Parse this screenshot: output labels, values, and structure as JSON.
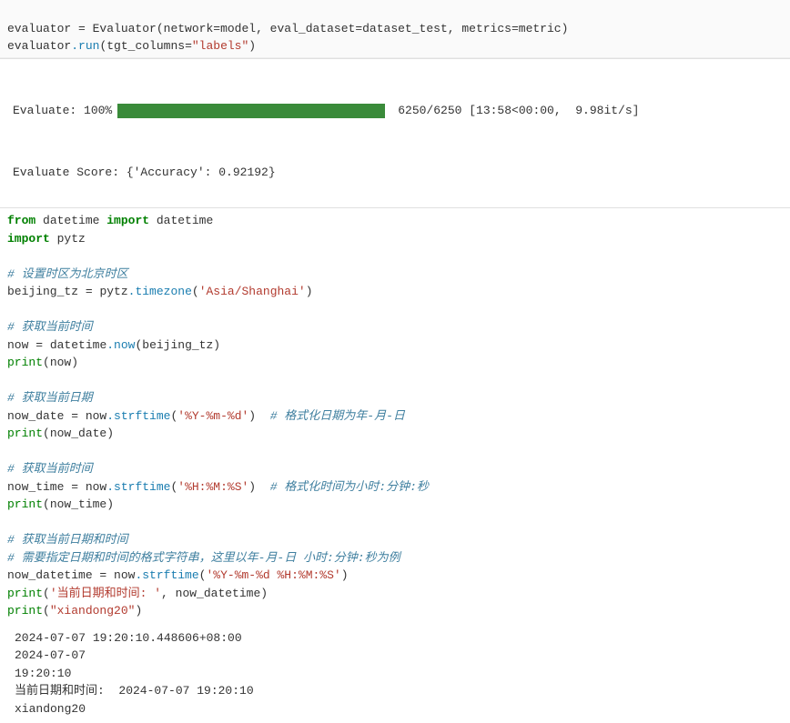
{
  "top_code": {
    "line1_a": "evaluator ",
    "line1_eq": "=",
    "line1_b": " Evaluator(network",
    "line1_c": "model, eval_dataset",
    "line1_d": "dataset_test, metrics",
    "line1_e": "metric)",
    "line2_a": "evaluator",
    "line2_run": ".run",
    "line2_b": "(tgt_columns",
    "line2_c": "=",
    "line2_str": "\"labels\"",
    "line2_d": ")"
  },
  "progress": {
    "label": "Evaluate: 100%",
    "stats": "6250/6250 [13:58<00:00,  9.98it/s]"
  },
  "score_line": "Evaluate Score: {'Accuracy': 0.92192}",
  "code": {
    "l1_from": "from",
    "l1_dt1": " datetime ",
    "l1_import": "import",
    "l1_dt2": " datetime",
    "l2_import": "import",
    "l2_pytz": " pytz",
    "c1": "# 设置时区为北京时区",
    "l3_a": "beijing_tz ",
    "l3_eq": "=",
    "l3_b": " pytz",
    "l3_tz": ".timezone",
    "l3_c": "(",
    "l3_str": "'Asia/Shanghai'",
    "l3_d": ")",
    "c2": "# 获取当前时间",
    "l4_a": "now ",
    "l4_eq": "=",
    "l4_b": " datetime",
    "l4_now": ".now",
    "l4_c": "(beijing_tz)",
    "l5_print": "print",
    "l5_b": "(now)",
    "c3": "# 获取当前日期",
    "l6_a": "now_date ",
    "l6_eq": "=",
    "l6_b": " now",
    "l6_strf": ".strftime",
    "l6_c": "(",
    "l6_str": "'%Y-%m-%d'",
    "l6_d": ")  ",
    "l6_cmt": "# 格式化日期为年-月-日",
    "l7_print": "print",
    "l7_b": "(now_date)",
    "c4": "# 获取当前时间",
    "l8_a": "now_time ",
    "l8_eq": "=",
    "l8_b": " now",
    "l8_strf": ".strftime",
    "l8_c": "(",
    "l8_str": "'%H:%M:%S'",
    "l8_d": ")  ",
    "l8_cmt": "# 格式化时间为小时:分钟:秒",
    "l9_print": "print",
    "l9_b": "(now_time)",
    "c5": "# 获取当前日期和时间",
    "c6": "# 需要指定日期和时间的格式字符串，这里以年-月-日 小时:分钟:秒为例",
    "l10_a": "now_datetime ",
    "l10_eq": "=",
    "l10_b": " now",
    "l10_strf": ".strftime",
    "l10_c": "(",
    "l10_str": "'%Y-%m-%d %H:%M:%S'",
    "l10_d": ")",
    "l11_print": "print",
    "l11_b": "(",
    "l11_str": "'当前日期和时间: '",
    "l11_c": ", now_datetime)",
    "l12_print": "print",
    "l12_b": "(",
    "l12_str": "\"xiandong20\"",
    "l12_c": ")"
  },
  "output": {
    "l1": "2024-07-07 19:20:10.448606+08:00",
    "l2": "2024-07-07",
    "l3": "19:20:10",
    "l4": "当前日期和时间:  2024-07-07 19:20:10",
    "l5": "xiandong20"
  }
}
